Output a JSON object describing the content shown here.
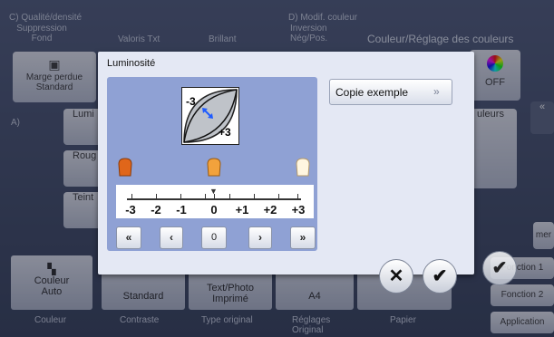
{
  "background": {
    "header_left": "C) Qualité/densité",
    "header_mid": "D) Modif. couleur",
    "tabs": [
      "Suppression\nFond",
      "Valoris Txt",
      "Brillant",
      "Inversion\nNég/Pos.",
      "Couleur/Réglage des couleurs"
    ],
    "left_button": "Marge perdue\nStandard",
    "off_label": "OFF",
    "couleurs_label": "uleurs",
    "side_labels": [
      "Lumi",
      "Roug",
      "Teint"
    ],
    "section_a": "A)",
    "bottom_buttons": [
      {
        "main": "Couleur\nAuto",
        "sub": "Couleur"
      },
      {
        "main": "Standard",
        "sub": "Contraste"
      },
      {
        "main": "Text/Photo\nImprimé",
        "sub": "Type original"
      },
      {
        "main": "A4",
        "sub": "Réglages\nOriginal"
      },
      {
        "main": "",
        "sub": "Papier"
      }
    ],
    "right_buttons": [
      "Fonction 1",
      "Fonction 2",
      "Application"
    ],
    "er_label": "mer"
  },
  "dialog": {
    "title": "Luminosité",
    "copie_button": "Copie exemple",
    "copie_icon": "double-chevron-right-icon",
    "curve_labels": {
      "minus": "-3",
      "plus": "+3"
    },
    "scale_labels": [
      "-3",
      "-2",
      "-1",
      "0",
      "+1",
      "+2",
      "+3"
    ],
    "current_value": "0",
    "nav": {
      "far_left": "«‹",
      "left": "‹",
      "value": "0",
      "right": "›",
      "far_right": "›»"
    },
    "cancel": "✕",
    "ok": "✔"
  }
}
